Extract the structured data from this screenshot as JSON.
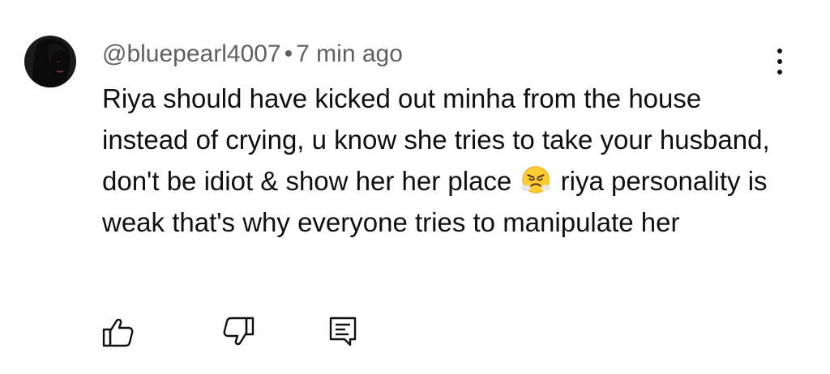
{
  "comment": {
    "author": "@bluepearl4007",
    "separator": "•",
    "time": "7 min ago",
    "text_before_emoji": "Riya should have kicked out minha from the house instead of crying, u know she tries to take your husband, don't be idiot & show her her place ",
    "emoji": "face-with-steam-from-nose",
    "text_after_emoji": " riya personality is weak that's why everyone tries to manipulate her"
  },
  "actions": {
    "like_icon": "thumbs-up-icon",
    "dislike_icon": "thumbs-down-icon",
    "reply_icon": "reply-icon",
    "menu_icon": "more-vert-icon"
  },
  "colors": {
    "meta_text": "#606060",
    "body_text": "#0f0f0f",
    "background": "#ffffff"
  }
}
